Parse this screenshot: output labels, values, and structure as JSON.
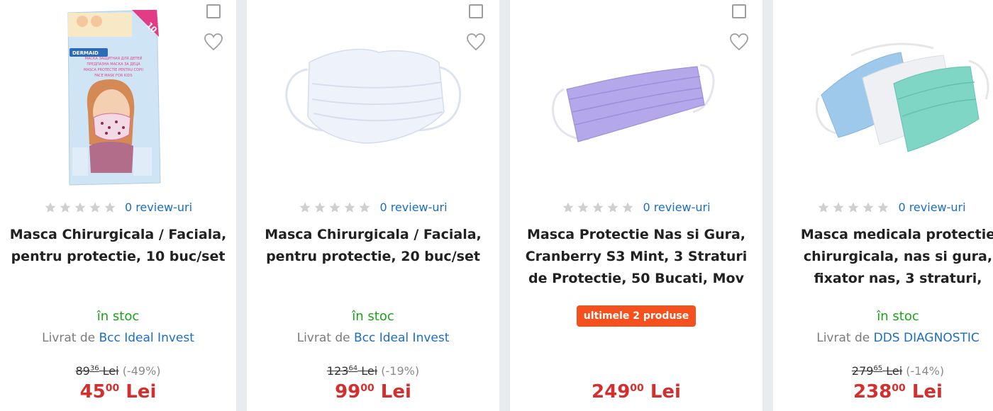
{
  "products": [
    {
      "reviews_label": "0 review-uri",
      "rating": 0,
      "title_lines": [
        "Masca Chirurgicala / Faciala,",
        "pentru protectie, 10 buc/set"
      ],
      "stock_label": "în stoc",
      "seller_prefix": "Livrat de",
      "seller_name": "Bcc Ideal Invest",
      "old_price_int": "89",
      "old_price_dec": "36",
      "old_currency": "Lei",
      "discount": "(-49%)",
      "price_int": "45",
      "price_dec": "00",
      "currency": "Lei"
    },
    {
      "reviews_label": "0 review-uri",
      "rating": 0,
      "title_lines": [
        "Masca Chirurgicala / Faciala,",
        "pentru protectie, 20 buc/set"
      ],
      "stock_label": "în stoc",
      "seller_prefix": "Livrat de",
      "seller_name": "Bcc Ideal Invest",
      "old_price_int": "123",
      "old_price_dec": "64",
      "old_currency": "Lei",
      "discount": "(-19%)",
      "price_int": "99",
      "price_dec": "00",
      "currency": "Lei"
    },
    {
      "reviews_label": "0 review-uri",
      "rating": 0,
      "title_lines": [
        "Masca Protectie Nas si Gura,",
        "Cranberry S3 Mint, 3 Straturi",
        "de Protectie, 50 Bucati, Mov"
      ],
      "badge": "ultimele 2 produse",
      "price_int": "249",
      "price_dec": "00",
      "currency": "Lei"
    },
    {
      "reviews_label": "0 review-uri",
      "rating": 0,
      "title_lines": [
        "Masca medicala protectie",
        "chirurgicala, nas si gura,",
        "fixator nas, 3 straturi,"
      ],
      "stock_label": "în stoc",
      "seller_prefix": "Livrat de",
      "seller_name": "DDS DIAGNOSTIC",
      "old_price_int": "279",
      "old_price_dec": "65",
      "old_currency": "Lei",
      "discount": "(-14%)",
      "price_int": "238",
      "price_dec": "00",
      "currency": "Lei"
    }
  ],
  "package_text": {
    "brand": "DERMAID",
    "count": "10",
    "lines": [
      "МАСКА ЗАЩИТНАЯ ДЛЯ ДЕТЕЙ",
      "ПРЕДПАЗНА МАСКА ЗА ДЕЦА",
      "MASCA PROTECTIE PENTRU COPII",
      "FACE MASK FOR KIDS"
    ]
  },
  "icons": {
    "compare": "checkbox-icon",
    "favorite": "heart-outline-icon",
    "star": "star-icon"
  },
  "colors": {
    "link": "#1a6ec4",
    "price": "#d32f2f",
    "stock": "#1aa41a",
    "badge": "#f4511e",
    "star_empty": "#cfcfcf"
  }
}
